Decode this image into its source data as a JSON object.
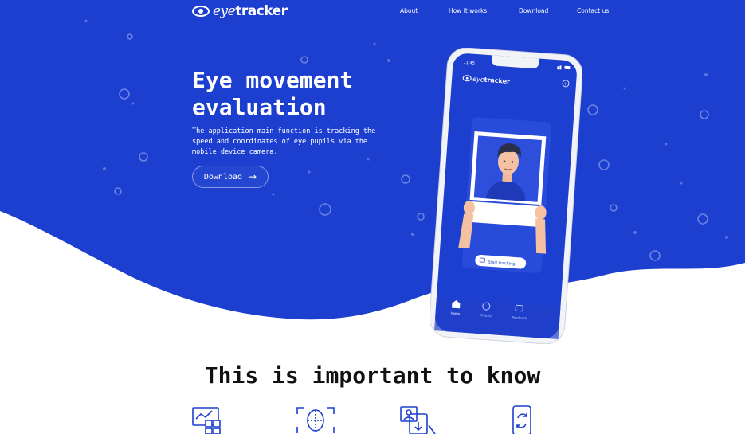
{
  "brand": {
    "logo_prefix": "eye",
    "logo_suffix": "tracker",
    "color_primary": "#1d3fd0",
    "color_text_dark": "#111111"
  },
  "nav": {
    "items": [
      "About",
      "How it works",
      "Download",
      "Contact us"
    ]
  },
  "hero": {
    "title_line1": "Eye movement",
    "title_line2": "evaluation",
    "description": "The application main function is tracking the speed and coordinates of eye pupils via the mobile device camera.",
    "download_label": "Download"
  },
  "phone": {
    "time": "11:45",
    "app_logo_prefix": "eye",
    "app_logo_suffix": "tracker",
    "start_button": "Start tracking!",
    "tabs": [
      "Home",
      "History",
      "Feedback"
    ]
  },
  "section": {
    "title": "This is important to know"
  },
  "features": {
    "icons": [
      "chart-grid-icon",
      "face-scan-icon",
      "photo-download-icon",
      "phone-refresh-icon"
    ]
  }
}
